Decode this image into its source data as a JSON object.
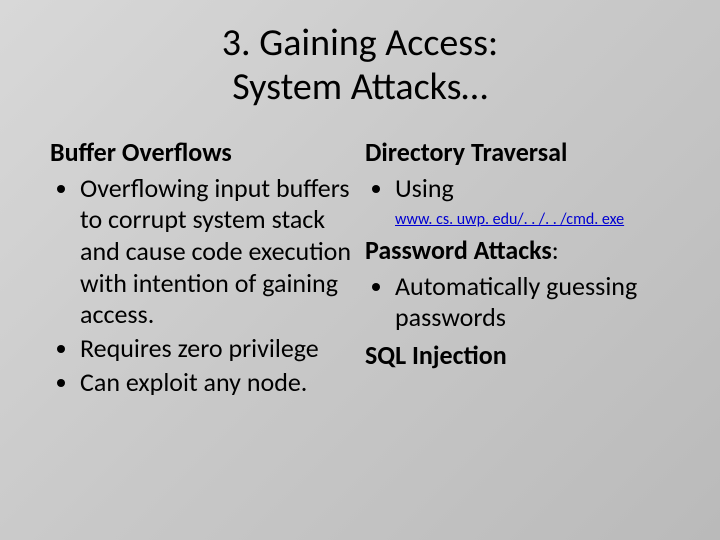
{
  "title_line1": "3. Gaining Access:",
  "title_line2": "System Attacks…",
  "left": {
    "heading": "Buffer Overflows",
    "bullets": [
      "Overflowing input buffers to corrupt system stack and cause code execution with intention of gaining access.",
      "Requires zero privilege",
      "Can exploit any node."
    ]
  },
  "right": {
    "heading1": "Directory Traversal",
    "bullet1": "Using",
    "link_text": "www. cs. uwp. edu/. . /. . /cmd. exe",
    "heading2_a": "Password Attacks",
    "heading2_b": ":",
    "bullet2": "Automatically guessing passwords",
    "heading3": "SQL Injection"
  }
}
